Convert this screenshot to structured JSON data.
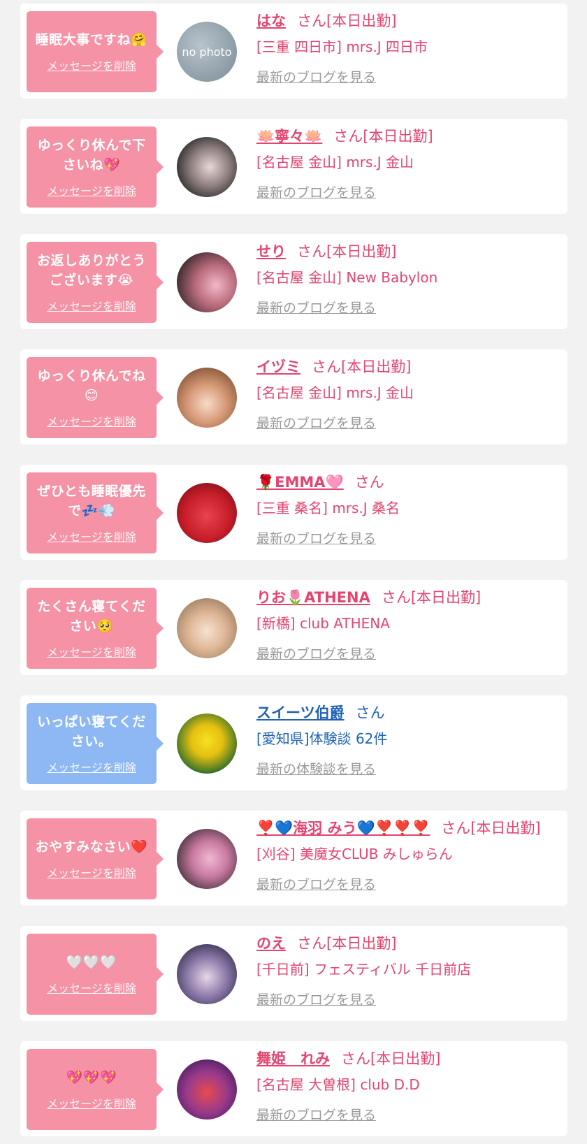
{
  "items": [
    {
      "message": "睡眠大事ですね🤗",
      "delete_label": "メッセージを削除",
      "name": "はな",
      "suffix": "さん[本日出勤]",
      "shop": "[三重 四日市] mrs.J 四日市",
      "link": "最新のブログを見る",
      "avatar_text": "no photo"
    },
    {
      "message": "ゆっくり休んで下さいね💖",
      "delete_label": "メッセージを削除",
      "name": "🪷寧々🪷",
      "suffix": "さん[本日出勤]",
      "shop": "[名古屋 金山] mrs.J 金山",
      "link": "最新のブログを見る",
      "avatar_text": ""
    },
    {
      "message": "お返しありがとうございます😭",
      "delete_label": "メッセージを削除",
      "name": "せり",
      "suffix": "さん[本日出勤]",
      "shop": "[名古屋 金山] New Babylon",
      "link": "最新のブログを見る",
      "avatar_text": ""
    },
    {
      "message": "ゆっくり休んでね😊",
      "delete_label": "メッセージを削除",
      "name": "イヅミ",
      "suffix": "さん[本日出勤]",
      "shop": "[名古屋 金山] mrs.J 金山",
      "link": "最新のブログを見る",
      "avatar_text": ""
    },
    {
      "message": "ぜひとも睡眠優先で💤💨",
      "delete_label": "メッセージを削除",
      "name": "🌹EMMA🩷",
      "suffix": "さん",
      "shop": "[三重 桑名] mrs.J 桑名",
      "link": "最新のブログを見る",
      "avatar_text": ""
    },
    {
      "message": "たくさん寝てください🥺",
      "delete_label": "メッセージを削除",
      "name": "りお🌷ATHENA",
      "suffix": "さん[本日出勤]",
      "shop": "[新橋] club ATHENA",
      "link": "最新のブログを見る",
      "avatar_text": ""
    },
    {
      "message": "いっぱい寝てください。",
      "delete_label": "メッセージを削除",
      "name": "スイーツ伯爵",
      "suffix": "さん",
      "shop": "[愛知県]体験談 62件",
      "link": "最新の体験談を見る",
      "avatar_text": ""
    },
    {
      "message": "おやすみなさい❤️",
      "delete_label": "メッセージを削除",
      "name": "❣️💙海羽 みう💙❣️❣️❣️",
      "suffix": "さん[本日出勤]",
      "shop": "[刈谷] 美魔女CLUB みしゅらん",
      "link": "最新のブログを見る",
      "avatar_text": ""
    },
    {
      "message": "🤍🤍🤍",
      "delete_label": "メッセージを削除",
      "name": "のえ",
      "suffix": "さん[本日出勤]",
      "shop": "[千日前] フェスティバル 千日前店",
      "link": "最新のブログを見る",
      "avatar_text": ""
    },
    {
      "message": "💖💖💖",
      "delete_label": "メッセージを削除",
      "name": "舞姫　れみ",
      "suffix": "さん[本日出勤]",
      "shop": "[名古屋 大曽根] club D.D",
      "link": "最新のブログを見る",
      "avatar_text": ""
    }
  ],
  "colors": {
    "pink": "#f592a5",
    "blue": "#8db8f3",
    "accent": "#e3456f",
    "link_blue": "#1f62b8"
  }
}
